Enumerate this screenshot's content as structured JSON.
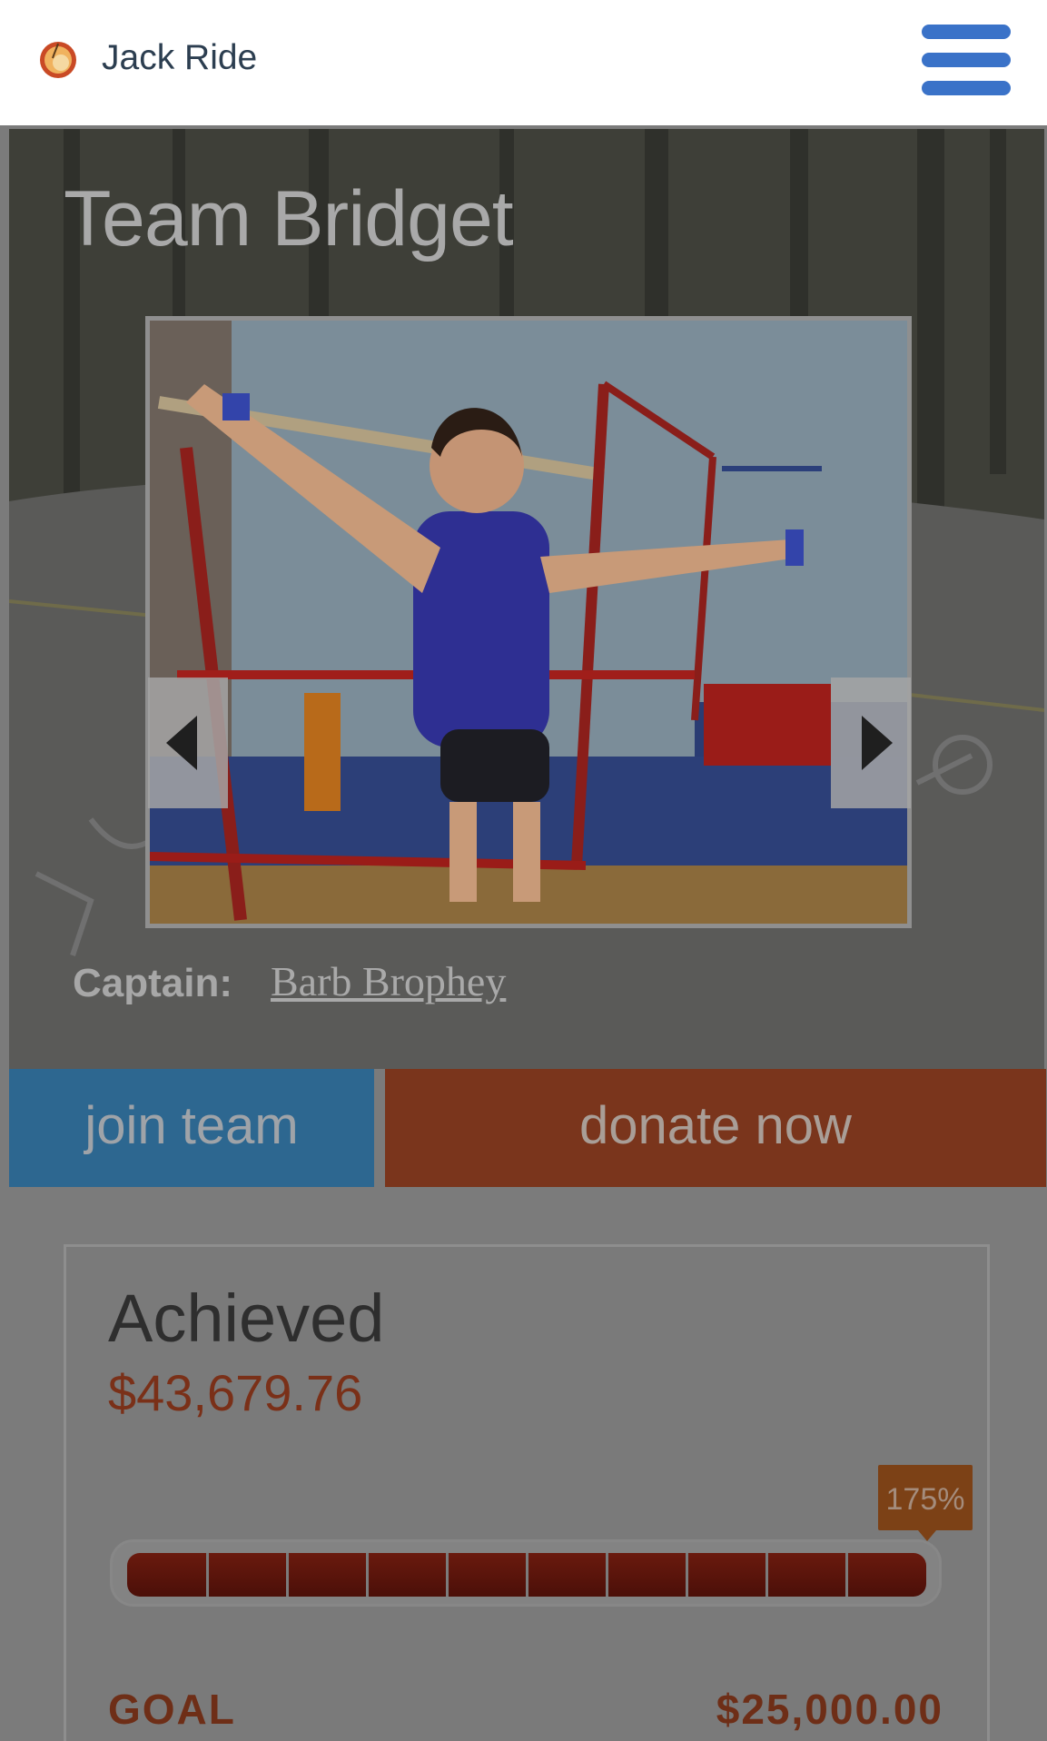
{
  "header": {
    "site_title": "Jack Ride",
    "logo_icon": "peach-icon",
    "menu_icon": "hamburger-menu-icon",
    "brand_color": "#3a72c8"
  },
  "hero": {
    "team_title": "Team Bridget",
    "captain_label": "Captain:",
    "captain_name": "Barb Brophey",
    "prev_icon": "chevron-left-icon",
    "next_icon": "chevron-right-icon"
  },
  "actions": {
    "join_label": "join team",
    "donate_label": "donate now",
    "join_color": "#2d6790",
    "donate_color": "#7a351c"
  },
  "fundraising": {
    "achieved_label": "Achieved",
    "achieved_amount": "$43,679.76",
    "percent_label": "175%",
    "progress_fraction": 1.0,
    "goal_label": "GOAL",
    "goal_amount": "$25,000.00"
  }
}
